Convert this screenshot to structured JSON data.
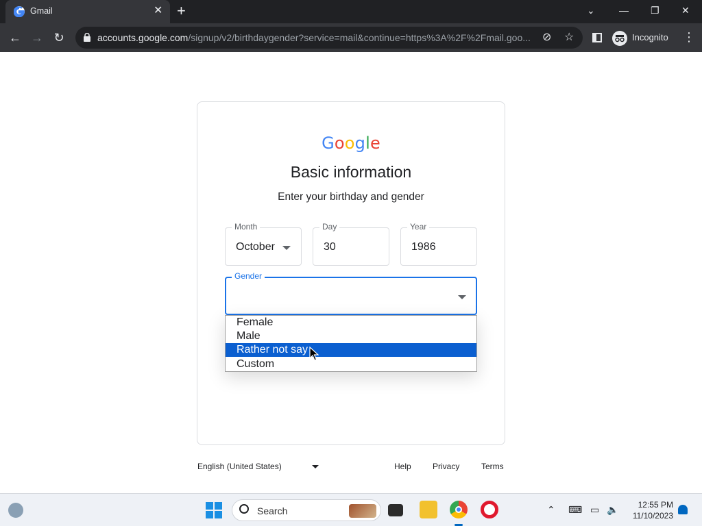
{
  "browser": {
    "tab_title": "Gmail",
    "url_host": "accounts.google.com",
    "url_path": "/signup/v2/birthdaygender?service=mail&continue=https%3A%2F%2Fmail.goo...",
    "profile_label": "Incognito"
  },
  "card": {
    "logo_letters": [
      "G",
      "o",
      "o",
      "g",
      "l",
      "e"
    ],
    "logo_colors": [
      "#4285f4",
      "#ea4335",
      "#fbbc05",
      "#4285f4",
      "#34a853",
      "#ea4335"
    ],
    "title": "Basic information",
    "subtitle": "Enter your birthday and gender",
    "month": {
      "label": "Month",
      "value": "October"
    },
    "day": {
      "label": "Day",
      "value": "30"
    },
    "year": {
      "label": "Year",
      "value": "1986"
    },
    "gender": {
      "label": "Gender",
      "value": "",
      "options": [
        "Female",
        "Male",
        "Rather not say",
        "Custom"
      ],
      "highlighted": "Rather not say"
    }
  },
  "footer": {
    "language": "English (United States)",
    "links": [
      "Help",
      "Privacy",
      "Terms"
    ]
  },
  "taskbar": {
    "search_placeholder": "Search",
    "time": "12:55 PM",
    "date": "11/10/2023"
  },
  "colors": {
    "accent_blue": "#1a73e8",
    "highlight": "#0b5fd0",
    "chrome_dark": "#202124"
  }
}
